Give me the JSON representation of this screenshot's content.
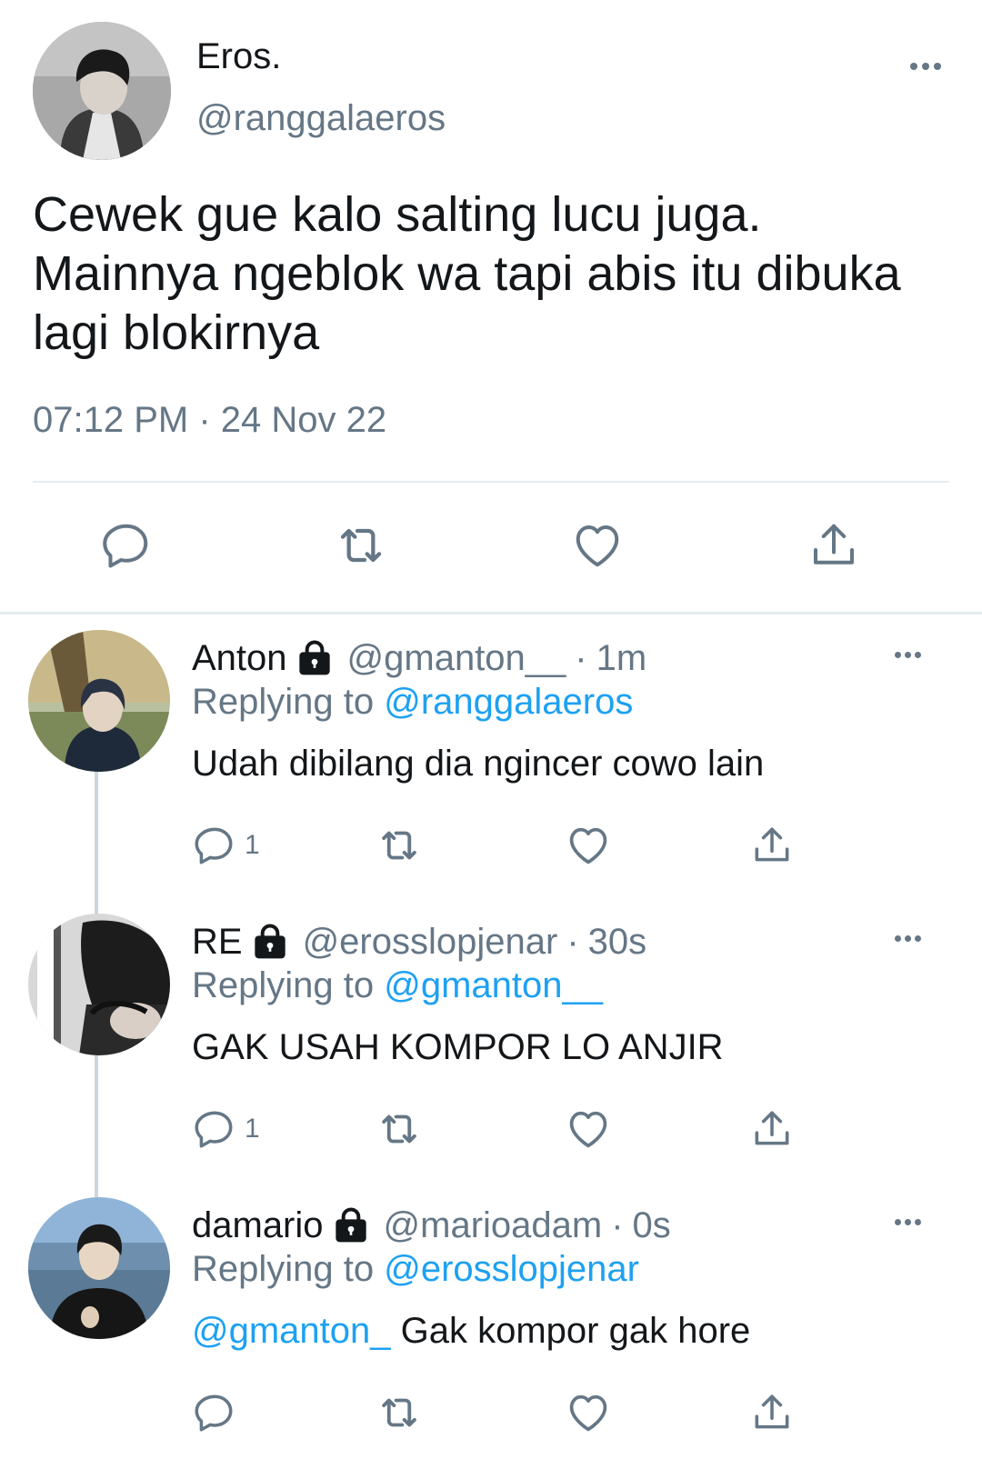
{
  "main_tweet": {
    "author_name": "Eros.",
    "author_handle": "@ranggalaeros",
    "text": "Cewek gue kalo salting lucu juga. Mainnya ngeblok wa tapi abis itu dibuka lagi blokirnya",
    "timestamp": "07:12 PM · 24 Nov 22",
    "icons": [
      "reply-icon",
      "retweet-icon",
      "like-icon",
      "share-icon",
      "more-icon"
    ]
  },
  "replies": [
    {
      "name": "Anton",
      "handle": "@gmanton__",
      "separator": "·",
      "time": "1m",
      "replying_label": "Replying to",
      "replying_to": "@ranggalaeros",
      "mention": "",
      "text": "Udah dibilang dia ngincer cowo lain",
      "reply_count": "1"
    },
    {
      "name": "RE",
      "handle": "@erosslopjenar",
      "separator": "·",
      "time": "30s",
      "replying_label": "Replying to",
      "replying_to": "@gmanton__",
      "mention": "",
      "text": "GAK USAH KOMPOR LO ANJIR",
      "reply_count": "1"
    },
    {
      "name": "damario",
      "handle": "@marioadam",
      "separator": "·",
      "time": "0s",
      "replying_label": "Replying to",
      "replying_to": "@erosslopjenar",
      "mention": "@gmanton_",
      "text": "Gak kompor gak hore",
      "reply_count": ""
    }
  ],
  "colors": {
    "text": "#14171a",
    "secondary": "#657786",
    "link": "#1da1f2",
    "divider": "#e6ecf0",
    "thread_line": "#ccd6dd"
  }
}
